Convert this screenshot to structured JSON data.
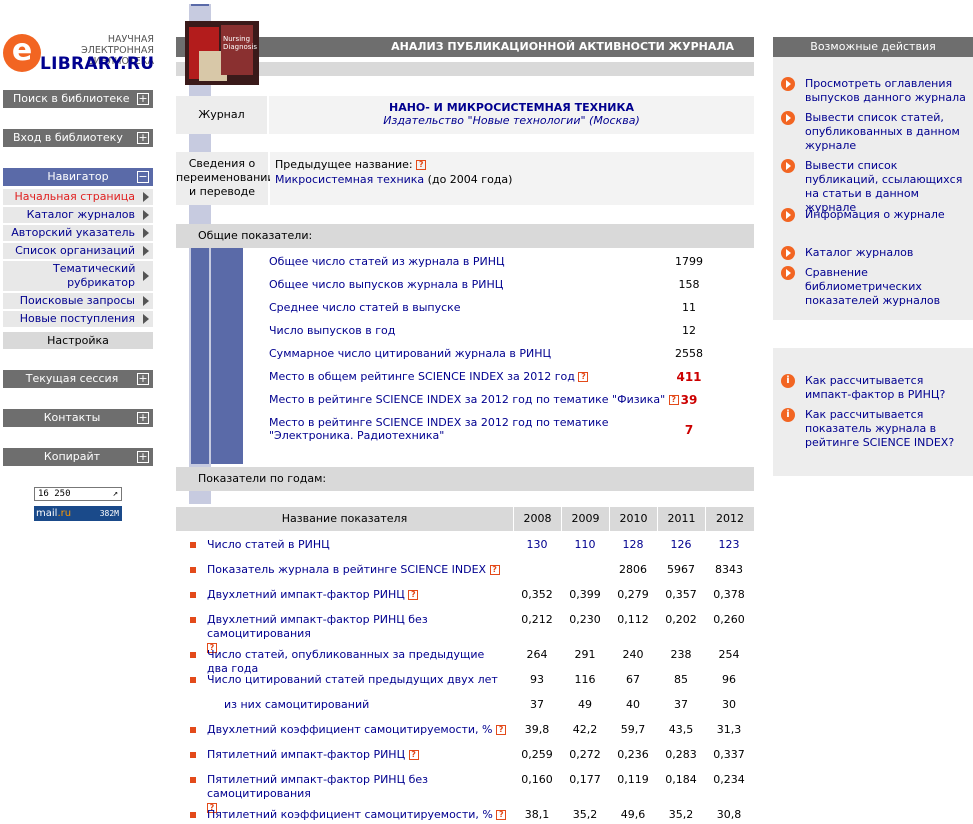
{
  "logo": {
    "top_line": "НАУЧНАЯ ЭЛЕКТРОННАЯ БИБЛИОТЕКА",
    "letter": "e",
    "name": "LIBRARY.RU"
  },
  "left_menu": {
    "search": "Поиск в библиотеке",
    "login": "Вход в библиотеку",
    "navigator": "Навигатор",
    "nav_items": [
      "Начальная страница",
      "Каталог журналов",
      "Авторский указатель",
      "Список организаций",
      "Тематический рубрикатор",
      "Поисковые запросы",
      "Новые поступления"
    ],
    "settings": "Настройка",
    "session": "Текущая сессия",
    "contacts": "Контакты",
    "copyright": "Копирайт",
    "counter": "16 250",
    "mailru": {
      "a": "mail",
      "b": ".ru",
      "num": "382M"
    }
  },
  "header": {
    "title": "АНАЛИЗ ПУБЛИКАЦИОННОЙ АКТИВНОСТИ ЖУРНАЛА",
    "cover_text": "Nursing Diagnosis"
  },
  "journal": {
    "label": "Журнал",
    "name": "НАНО- И МИКРОСИСТЕМНАЯ ТЕХНИКА",
    "publisher": "Издательство \"Новые технологии\" (Москва)",
    "rename_label": "Сведения о переименовании и переводе",
    "prev_name_label": "Предыдущее название:",
    "prev_name_link": "Микросистемная техника",
    "prev_name_suffix": "(до 2004 года)"
  },
  "general": {
    "title": "Общие показатели:",
    "rows": [
      {
        "label": "Общее число статей из журнала в РИНЦ",
        "value": "1799"
      },
      {
        "label": "Общее число выпусков журнала в РИНЦ",
        "value": "158"
      },
      {
        "label": "Среднее число статей в выпуске",
        "value": "11"
      },
      {
        "label": "Число выпусков в год",
        "value": "12"
      },
      {
        "label": "Суммарное число цитирований журнала в РИНЦ",
        "value": "2558"
      },
      {
        "label": "Место в общем рейтинге SCIENCE INDEX за 2012 год",
        "value": "411"
      },
      {
        "label": "Место в рейтинге SCIENCE INDEX за 2012 год по тематике \"Физика\"",
        "value": "39"
      },
      {
        "label": "Место в рейтинге SCIENCE INDEX за 2012 год по тематике \"Электроника. Радиотехника\"",
        "value": "7"
      }
    ]
  },
  "yearly": {
    "title": "Показатели по годам:",
    "col_name": "Название показателя",
    "years": [
      "2008",
      "2009",
      "2010",
      "2011",
      "2012"
    ],
    "rows": [
      {
        "label": "Число статей в РИНЦ",
        "values": [
          "130",
          "110",
          "128",
          "126",
          "123"
        ]
      },
      {
        "label": "Показатель журнала в рейтинге SCIENCE INDEX",
        "values": [
          "",
          "",
          "2806",
          "5967",
          "8343"
        ]
      },
      {
        "label": "Двухлетний импакт-фактор РИНЦ",
        "values": [
          "0,352",
          "0,399",
          "0,279",
          "0,357",
          "0,378"
        ]
      },
      {
        "label": "Двухлетний импакт-фактор РИНЦ без самоцитирования",
        "values": [
          "0,212",
          "0,230",
          "0,112",
          "0,202",
          "0,260"
        ]
      },
      {
        "label": "Число статей, опубликованных за предыдущие два года",
        "values": [
          "264",
          "291",
          "240",
          "238",
          "254"
        ]
      },
      {
        "label": "Число цитирований статей предыдущих двух лет",
        "values": [
          "93",
          "116",
          "67",
          "85",
          "96"
        ]
      },
      {
        "label": "из них самоцитирований",
        "values": [
          "37",
          "49",
          "40",
          "37",
          "30"
        ]
      },
      {
        "label": "Двухлетний коэффициент самоцитируемости, %",
        "values": [
          "39,8",
          "42,2",
          "59,7",
          "43,5",
          "31,3"
        ]
      },
      {
        "label": "Пятилетний импакт-фактор РИНЦ",
        "values": [
          "0,259",
          "0,272",
          "0,236",
          "0,283",
          "0,337"
        ]
      },
      {
        "label": "Пятилетний импакт-фактор РИНЦ без самоцитирования",
        "values": [
          "0,160",
          "0,177",
          "0,119",
          "0,184",
          "0,234"
        ]
      },
      {
        "label": "Пятилетний коэффициент самоцитируемости, %",
        "values": [
          "38,1",
          "35,2",
          "49,6",
          "35,2",
          "30,8"
        ]
      }
    ]
  },
  "right": {
    "title": "Возможные действия",
    "actions": [
      "Просмотреть оглавления выпусков данного журнала",
      "Вывести список статей, опубликованных в данном журнале",
      "Вывести список публикаций, ссылающихся на статьи в данном журнале",
      "Информация о журнале",
      "Каталог журналов",
      "Сравнение библиометрических показателей журналов"
    ],
    "info": [
      "Как рассчитывается импакт-фактор в РИНЦ?",
      "Как рассчитывается показатель журнала в рейтинге SCIENCE INDEX?"
    ]
  },
  "help_glyph": "?",
  "info_glyph": "i"
}
